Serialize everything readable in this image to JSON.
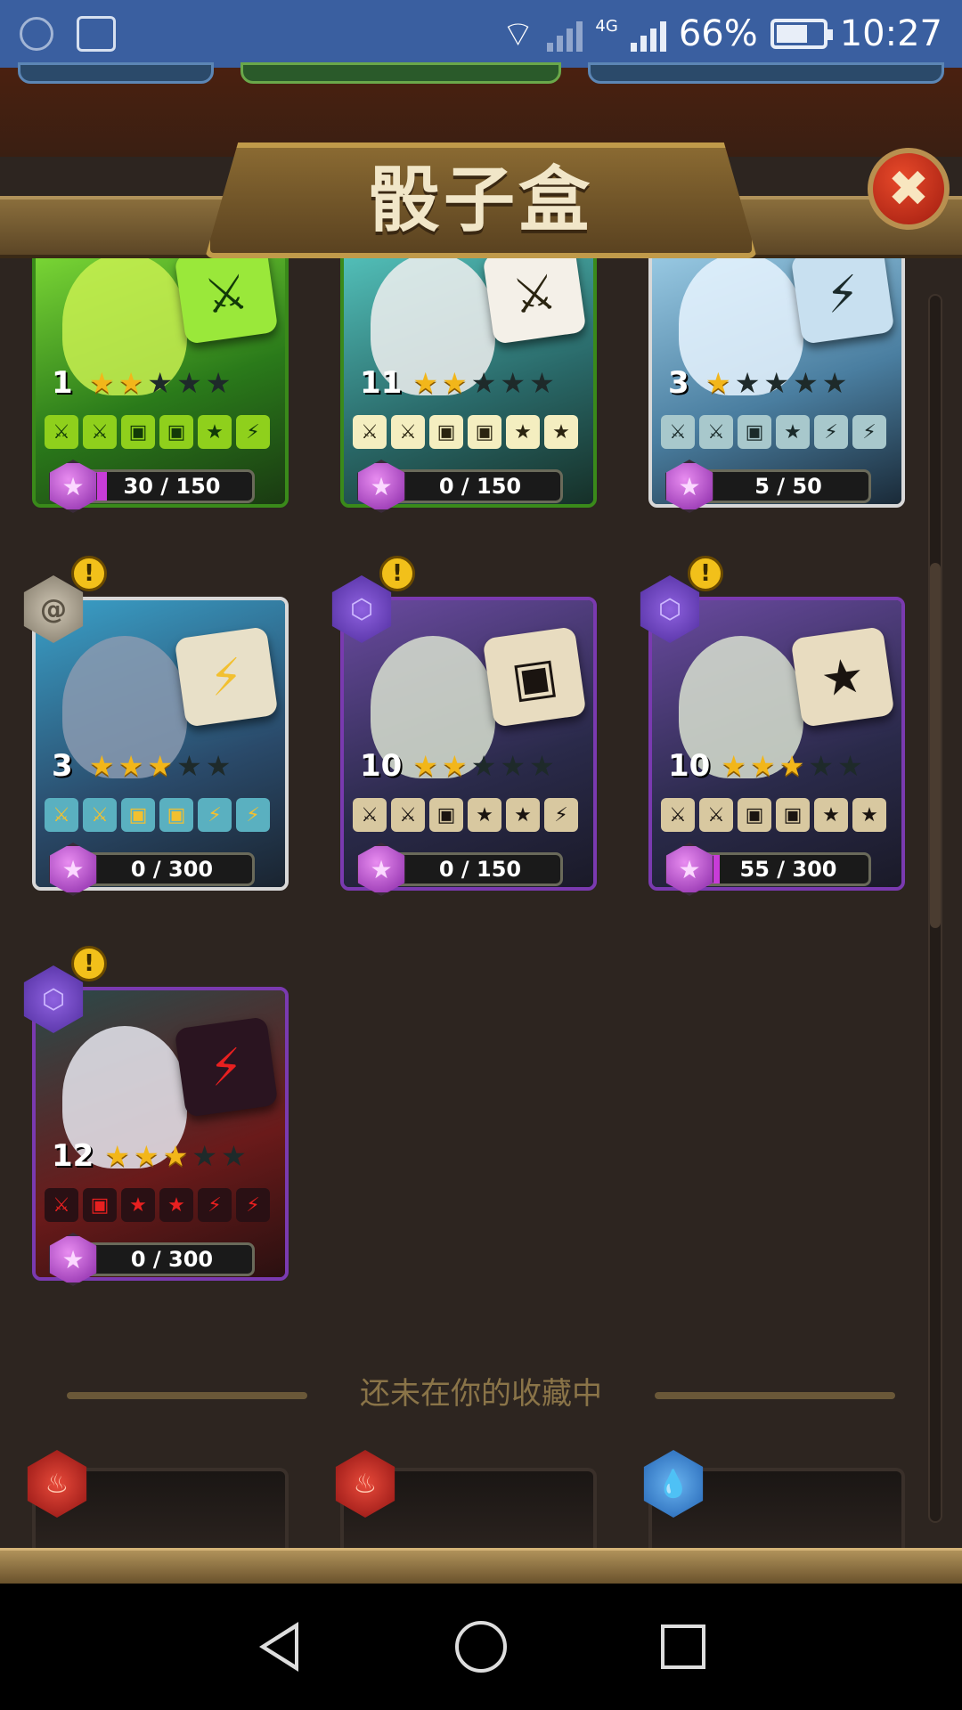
{
  "status_bar": {
    "battery_percent": "66%",
    "time": "10:27",
    "network": "4G"
  },
  "header": {
    "title": "骰子盒",
    "close_label": "✖"
  },
  "section": {
    "not_in_collection": "还未在你的收藏中"
  },
  "cards": [
    {
      "level": "1",
      "stars": 2,
      "progress_text": "30 / 150",
      "progress": 0.2,
      "faces": [
        "⚔",
        "⚔",
        "▣",
        "▣",
        "★",
        "⚡"
      ],
      "theme": "green",
      "badge": null,
      "warn": false,
      "dice_icon": "⚔"
    },
    {
      "level": "11",
      "stars": 2,
      "progress_text": "0 / 150",
      "progress": 0.0,
      "faces": [
        "⚔",
        "⚔",
        "▣",
        "▣",
        "★",
        "★"
      ],
      "theme": "cream",
      "badge": null,
      "warn": false,
      "dice_icon": "⚔"
    },
    {
      "level": "3",
      "stars": 1,
      "progress_text": "5 / 50",
      "progress": 0.1,
      "faces": [
        "⚔",
        "⚔",
        "▣",
        "★",
        "⚡",
        "⚡"
      ],
      "theme": "blue",
      "badge": null,
      "warn": false,
      "dice_icon": "⚡"
    },
    {
      "level": "3",
      "stars": 3,
      "progress_text": "0 / 300",
      "progress": 0.0,
      "faces": [
        "⚔",
        "⚔",
        "▣",
        "▣",
        "⚡",
        "⚡"
      ],
      "theme": "grey",
      "badge": "grey",
      "warn": true,
      "dice_icon": "⚡"
    },
    {
      "level": "10",
      "stars": 2,
      "progress_text": "0 / 150",
      "progress": 0.0,
      "faces": [
        "⚔",
        "⚔",
        "▣",
        "★",
        "★",
        "⚡"
      ],
      "theme": "purple",
      "badge": "purple",
      "warn": true,
      "dice_icon": "▣"
    },
    {
      "level": "10",
      "stars": 3,
      "progress_text": "55 / 300",
      "progress": 0.18,
      "faces": [
        "⚔",
        "⚔",
        "▣",
        "▣",
        "★",
        "★"
      ],
      "theme": "purple",
      "badge": "purple",
      "warn": true,
      "dice_icon": "★"
    },
    {
      "level": "12",
      "stars": 3,
      "progress_text": "0 / 300",
      "progress": 0.0,
      "faces": [
        "⚔",
        "▣",
        "★",
        "★",
        "⚡",
        "⚡"
      ],
      "theme": "red",
      "badge": "purple",
      "warn": true,
      "dice_icon": "⚡"
    }
  ],
  "locked_cards": [
    {
      "element": "fire-icon",
      "badge": "red",
      "glyph": "♨"
    },
    {
      "element": "fire-icon",
      "badge": "red",
      "glyph": "♨"
    },
    {
      "element": "water-drop-icon",
      "badge": "blue",
      "glyph": "💧"
    }
  ]
}
